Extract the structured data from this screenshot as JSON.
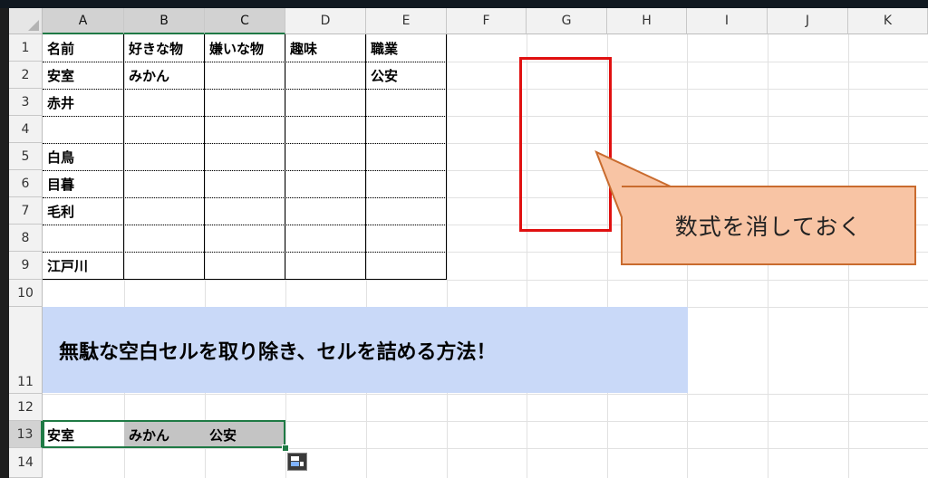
{
  "columns": [
    "A",
    "B",
    "C",
    "D",
    "E",
    "F",
    "G",
    "H",
    "I",
    "J",
    "K"
  ],
  "rows": [
    "1",
    "2",
    "3",
    "4",
    "5",
    "6",
    "7",
    "8",
    "9",
    "10",
    "11",
    "12",
    "13",
    "14"
  ],
  "cells": {
    "A1": "名前",
    "B1": "好きな物",
    "C1": "嫌いな物",
    "D1": "趣味",
    "E1": "職業",
    "A2": "安室",
    "B2": "みかん",
    "E2": "公安",
    "A3": "赤井",
    "A5": "白鳥",
    "A6": "目暮",
    "A7": "毛利",
    "A9": "江戸川",
    "A13": "安室",
    "B13": "みかん",
    "C13": "公安"
  },
  "banner": {
    "text": "無駄な空白セルを取り除き、セルを詰める方法！"
  },
  "callout": {
    "text": "数式を消しておく"
  },
  "colors": {
    "selection": "#1f7a45",
    "banner_bg": "#c9d9f8",
    "callout_fill": "#f8c4a4",
    "callout_border": "#c96b2e",
    "red_box": "#e01010",
    "selected_cells": "#c4c4c4"
  },
  "icons": {
    "quick_analysis": "quick-analysis-icon"
  }
}
